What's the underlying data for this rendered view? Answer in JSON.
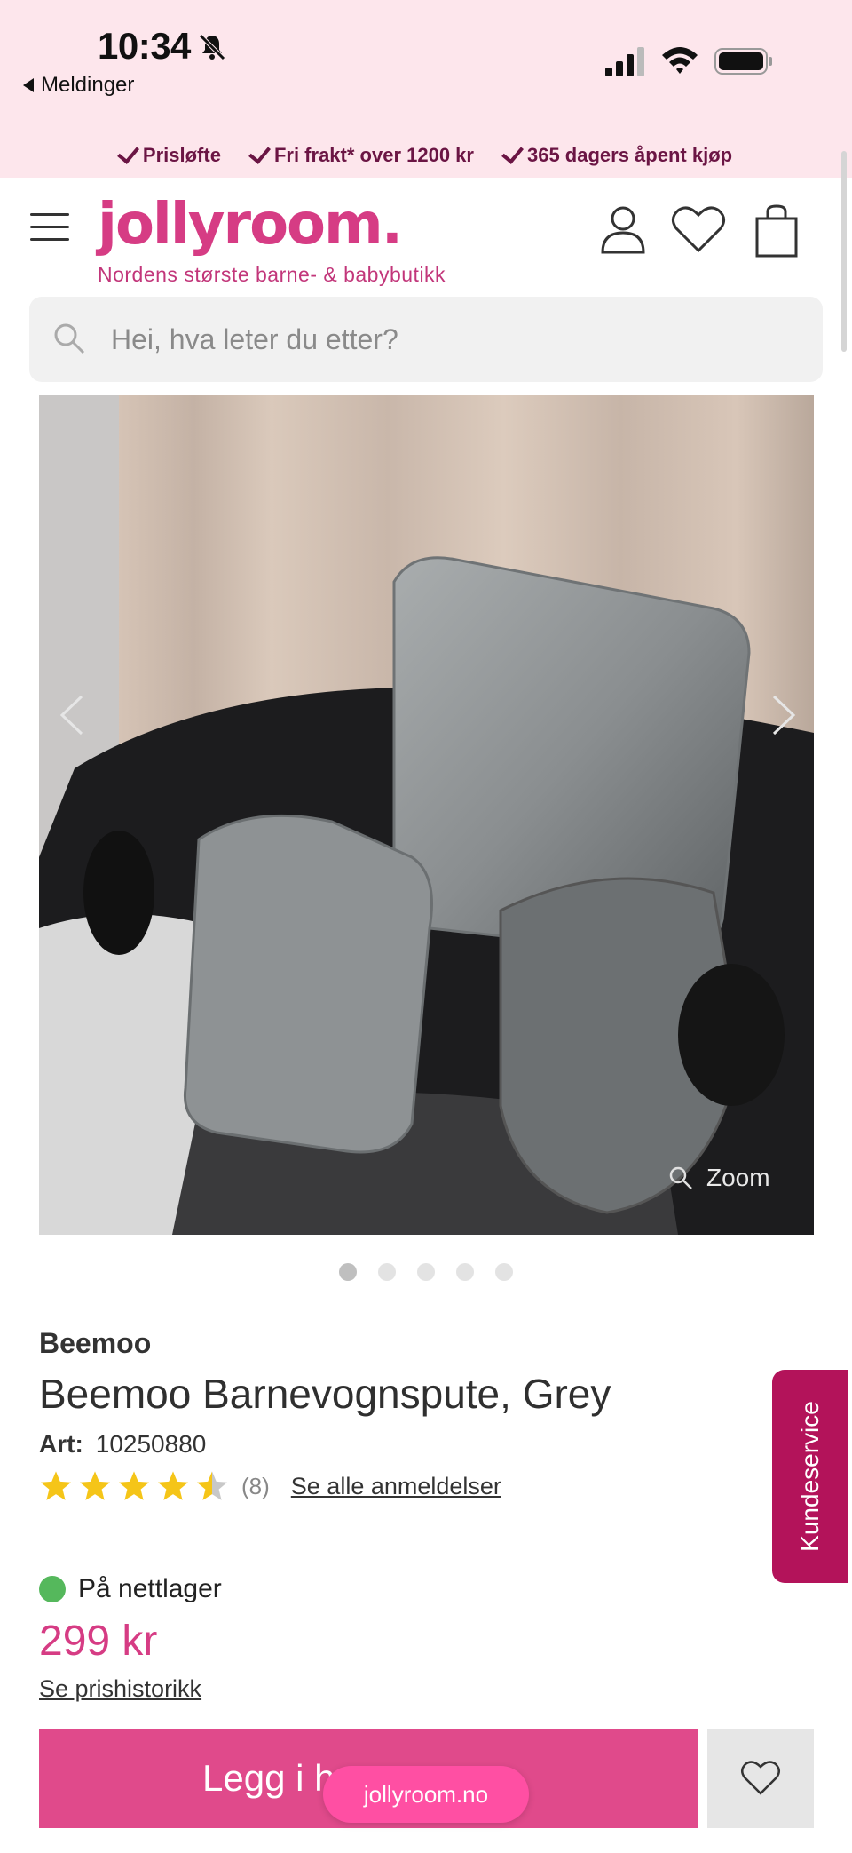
{
  "status_bar": {
    "time": "10:34",
    "back_label": "Meldinger"
  },
  "usp": {
    "items": [
      "Prisløfte",
      "Fri frakt* over 1200 kr",
      "365 dagers åpent kjøp"
    ]
  },
  "header": {
    "logo": "jollyroom.",
    "tagline": "Nordens største barne- & babybutikk"
  },
  "search": {
    "placeholder": "Hei, hva leter du etter?"
  },
  "gallery": {
    "zoom_label": "Zoom",
    "image_count": 5,
    "active_index": 0
  },
  "product": {
    "brand": "Beemoo",
    "title": "Beemoo Barnevognspute, Grey",
    "art_label": "Art:",
    "art_number": "10250880",
    "rating_value": 4.5,
    "rating_max": 5,
    "review_count": "(8)",
    "reviews_link": "Se alle anmeldelser",
    "stock_status": "På nettlager",
    "price": "299 kr",
    "price_history_link": "Se prishistorikk",
    "add_to_cart_label": "Legg i h"
  },
  "browser": {
    "url": "jollyroom.no"
  },
  "kundeservice": {
    "label": "Kundeservice"
  },
  "colors": {
    "brand_pink": "#d63c84",
    "header_bg": "#fde6ec",
    "usp_text": "#6b1544",
    "kundeservice_bg": "#b3135a",
    "stock_green": "#55b85c",
    "star_yellow": "#f5c518"
  }
}
